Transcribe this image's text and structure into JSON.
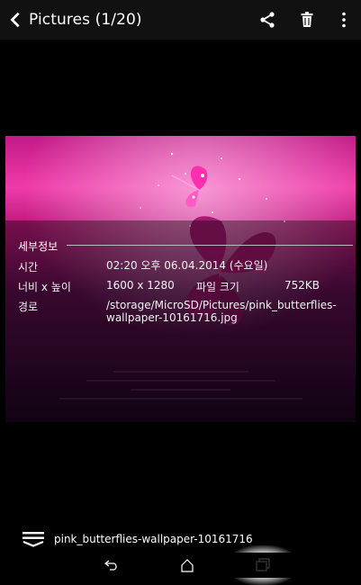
{
  "appbar": {
    "title": "Pictures (1/20)",
    "icons": [
      "chevron-left-icon",
      "share-icon",
      "trash-icon",
      "overflow-menu-icon"
    ]
  },
  "details": {
    "heading": "세부정보",
    "time_label": "시간",
    "time_value": "02:20 오후 06.04.2014 (수요일)",
    "dims_label": "너비 x 높이",
    "dims_value": "1600 x 1280",
    "size_label": "파일 크기",
    "size_value": "752KB",
    "path_label": "경로",
    "path_line1": "/storage/MicroSD/Pictures/pink_butterflies-",
    "path_line2": "wallpaper-10161716.jpg"
  },
  "bottom": {
    "filename": "pink_butterflies-wallpaper-10161716"
  },
  "navbar": {
    "buttons": [
      "back-icon",
      "home-icon",
      "recents-icon"
    ]
  },
  "colors": {
    "accent_pink": "#d11a8b",
    "image_bg_top": "#e62b9f",
    "image_bg_bottom": "#2a0828"
  }
}
